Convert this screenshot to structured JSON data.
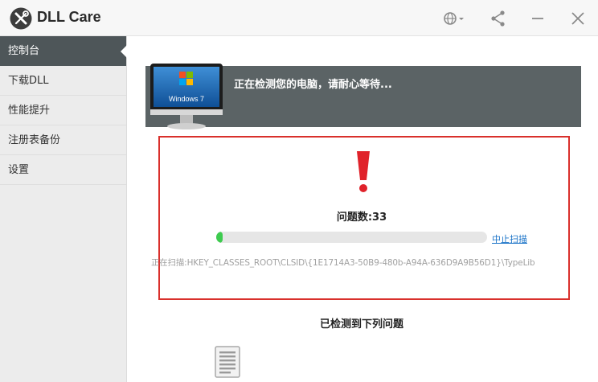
{
  "app": {
    "title": "DLL Care",
    "logo_icon": "wrench-screwdriver-icon"
  },
  "titlebar": {
    "icons": [
      "globe-icon",
      "share-icon",
      "minimize-icon",
      "close-icon"
    ]
  },
  "sidebar": {
    "items": [
      {
        "label": "控制台",
        "active": true
      },
      {
        "label": "下载DLL",
        "active": false
      },
      {
        "label": "性能提升",
        "active": false
      },
      {
        "label": "注册表备份",
        "active": false
      },
      {
        "label": "设置",
        "active": false
      }
    ]
  },
  "banner": {
    "os_label": "Windows 7",
    "status_text": "正在检测您的电脑，请耐心等待..."
  },
  "scan": {
    "issue_count_label": "问题数:33",
    "progress": 0.02,
    "stop_label": "中止扫描",
    "current_path": "正在扫描:HKEY_CLASSES_ROOT\\CLSID\\{1E1714A3-50B9-480b-A94A-636D9A9B56D1}\\TypeLib"
  },
  "results": {
    "title": "已检测到下列问题"
  },
  "colors": {
    "accent_red": "#d9302c",
    "progress_green": "#3ecb4f",
    "link_blue": "#1a73c8",
    "sidebar_active": "#4e5659",
    "banner_bg": "#5b6365"
  }
}
